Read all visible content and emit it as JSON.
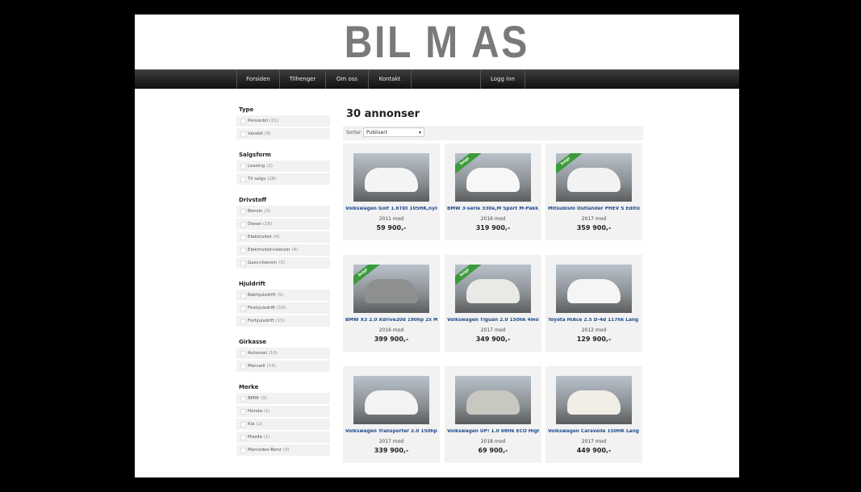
{
  "header": {
    "logo_text": "BIL M AS"
  },
  "nav": {
    "items": [
      {
        "label": "Forsiden"
      },
      {
        "label": "Tilhenger"
      },
      {
        "label": "Om oss"
      },
      {
        "label": "Kontakt"
      },
      {
        "label": ""
      },
      {
        "label": "Logg inn"
      }
    ]
  },
  "filters": [
    {
      "heading": "Type",
      "options": [
        {
          "label": "Personbil",
          "count": "(21)"
        },
        {
          "label": "Varebil",
          "count": "(9)"
        }
      ]
    },
    {
      "heading": "Salgsform",
      "options": [
        {
          "label": "Leasing",
          "count": "(2)"
        },
        {
          "label": "Til salgs",
          "count": "(28)"
        }
      ]
    },
    {
      "heading": "Drivstoff",
      "options": [
        {
          "label": "Bensin",
          "count": "(3)"
        },
        {
          "label": "Diesel",
          "count": "(16)"
        },
        {
          "label": "Elektrisitet",
          "count": "(4)"
        },
        {
          "label": "Elektrisitet+bensin",
          "count": "(4)"
        },
        {
          "label": "Gass+bensin",
          "count": "(3)"
        }
      ]
    },
    {
      "heading": "Hjuldrift",
      "options": [
        {
          "label": "Bakhjulsdrift",
          "count": "(5)"
        },
        {
          "label": "Firehjulsdrift",
          "count": "(10)"
        },
        {
          "label": "Forhjulsdrift",
          "count": "(15)"
        }
      ]
    },
    {
      "heading": "Girkasse",
      "options": [
        {
          "label": "Automat",
          "count": "(16)"
        },
        {
          "label": "Manuell",
          "count": "(14)"
        }
      ]
    },
    {
      "heading": "Merke",
      "options": [
        {
          "label": "BMW",
          "count": "(3)"
        },
        {
          "label": "Honda",
          "count": "(1)"
        },
        {
          "label": "Kia",
          "count": "(2)"
        },
        {
          "label": "Mazda",
          "count": "(1)"
        },
        {
          "label": "Mercedes-Benz",
          "count": "(3)"
        }
      ]
    }
  ],
  "listing": {
    "count_label": "30 annonser",
    "sort_label": "Sorter",
    "sort_value": "Publisert",
    "sold_label": "Solgt",
    "cards": [
      {
        "title": "Volkswagen Golf 1.6TDI 105HK,nyli...",
        "year": "2011 mod",
        "price": "59 900,-",
        "sold": false,
        "car_color": "#f4f4f4"
      },
      {
        "title": "BMW 3-serie 330e,M Sport M-Pakk...",
        "year": "2016 mod",
        "price": "319 900,-",
        "sold": true,
        "car_color": "#f7f7f7"
      },
      {
        "title": "Mitsubishi Outlander PHEV S Editio...",
        "year": "2017 mod",
        "price": "359 900,-",
        "sold": true,
        "car_color": "#f2f2f2"
      },
      {
        "title": "BMW X3 2.0 Xdrive20d 190hp 2x M...",
        "year": "2016 mod",
        "price": "399 900,-",
        "sold": true,
        "car_color": "#8e9090"
      },
      {
        "title": "Volkswagen Tiguan 2.0 150hk 4mot...",
        "year": "2017 mod",
        "price": "349 900,-",
        "sold": true,
        "car_color": "#e9e9e6"
      },
      {
        "title": "Toyota HiAce 2.5 D-4d 117hk Lang ...",
        "year": "2012 mod",
        "price": "129 900,-",
        "sold": false,
        "car_color": "#f5f5f5"
      },
      {
        "title": "Volkswagen Transporter 2.0 150hp ...",
        "year": "2017 mod",
        "price": "339 900,-",
        "sold": false,
        "car_color": "#f3f3f3"
      },
      {
        "title": "Volkswagen UP! 1.0 68Hk ECO High...",
        "year": "2018 mod",
        "price": "69 900,-",
        "sold": false,
        "car_color": "#c8c8c0"
      },
      {
        "title": "Volkswagen Caravelle 150HK Lang ...",
        "year": "2017 mod",
        "price": "449 900,-",
        "sold": false,
        "car_color": "#f1eee6"
      }
    ]
  }
}
